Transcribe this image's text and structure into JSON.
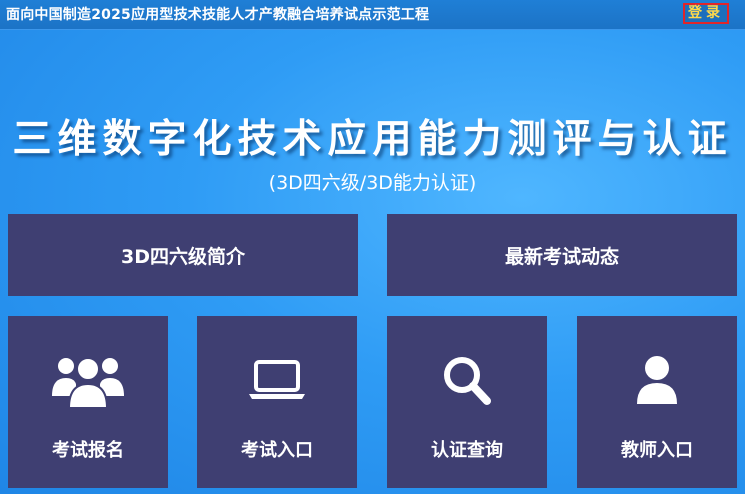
{
  "header": {
    "title": "面向中国制造2025应用型技术技能人才产教融合培养试点示范工程",
    "login_label": "登录"
  },
  "hero": {
    "title": "三维数字化技术应用能力测评与认证",
    "subtitle": "(3D四六级/3D能力认证)"
  },
  "cards": {
    "intro": "3D四六级简介",
    "news": "最新考试动态"
  },
  "tiles": [
    {
      "label": "考试报名",
      "icon": "users-icon"
    },
    {
      "label": "考试入口",
      "icon": "laptop-icon"
    },
    {
      "label": "认证查询",
      "icon": "search-icon"
    },
    {
      "label": "教师入口",
      "icon": "user-icon"
    }
  ],
  "colors": {
    "background": "#2f9cf5",
    "card": "#3f3f72",
    "login_border": "#e1252a",
    "login_text": "#ffd84a"
  }
}
